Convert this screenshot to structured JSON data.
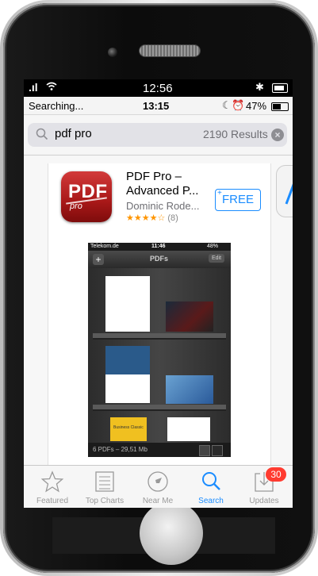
{
  "outer_status": {
    "signal": ".ıl",
    "time": "12:56",
    "battery_icon": "battery-icon"
  },
  "inner_status": {
    "carrier": "Searching...",
    "time": "13:15",
    "battery_percent": "47%"
  },
  "search": {
    "query": "pdf pro",
    "results": "2190 Results"
  },
  "app": {
    "icon_text": "PDF",
    "icon_sub": "pro",
    "title_line1": "PDF Pro –",
    "title_line2": "Advanced P...",
    "developer": "Dominic Rode...",
    "stars": "★★★★☆",
    "rating_count": "(8)",
    "price": "FREE"
  },
  "screenshot": {
    "status_carrier": "Telekom.de",
    "status_time": "11:46",
    "status_battery": "48%",
    "title": "PDFs",
    "edit": "Edit",
    "footer": "6 PDFs – 29,51 Mb",
    "book_title": "Business Classic"
  },
  "tabs": [
    {
      "label": "Featured",
      "icon": "star-icon"
    },
    {
      "label": "Top Charts",
      "icon": "list-icon"
    },
    {
      "label": "Near Me",
      "icon": "location-icon"
    },
    {
      "label": "Search",
      "icon": "search-icon"
    },
    {
      "label": "Updates",
      "icon": "download-icon",
      "badge": "30"
    }
  ],
  "colors": {
    "accent": "#1a8cff",
    "badge": "#ff3b30",
    "icon_red": "#c02020"
  }
}
